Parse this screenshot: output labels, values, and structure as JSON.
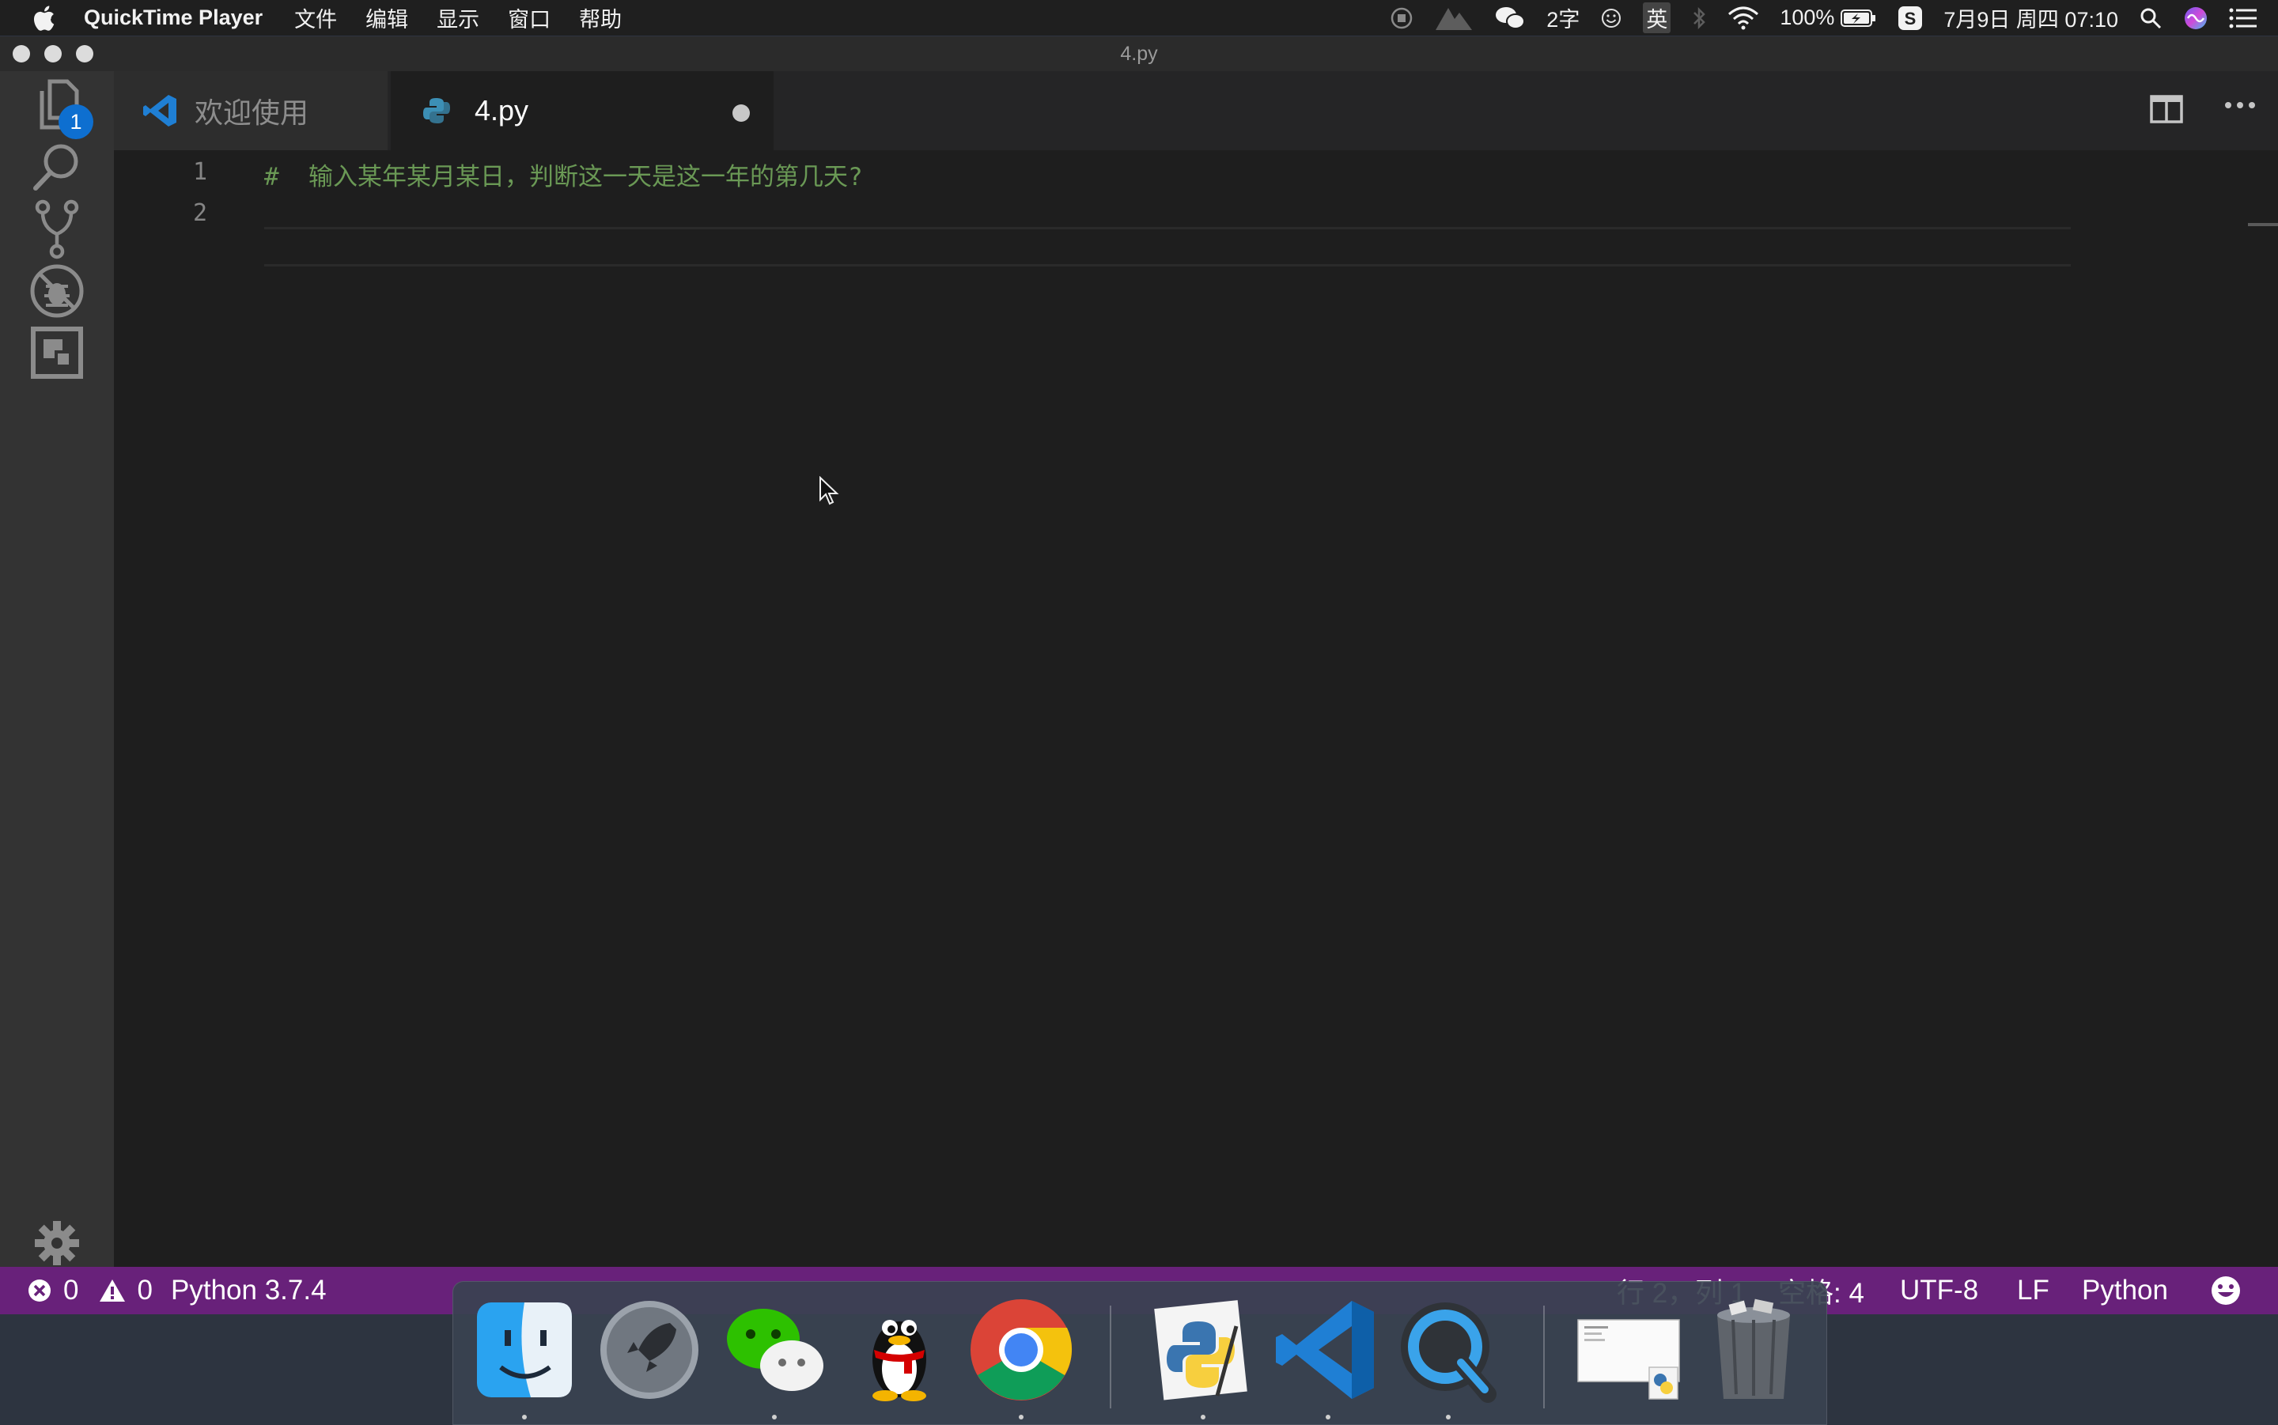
{
  "menubar": {
    "app_name": "QuickTime Player",
    "menus": [
      "文件",
      "编辑",
      "显示",
      "窗口",
      "帮助"
    ],
    "status": {
      "ime_count": "2字",
      "ime_lang": "英",
      "battery": "100%",
      "datetime": "7月9日 周四 07:10"
    }
  },
  "window": {
    "title": "4.py"
  },
  "activity_bar": {
    "explorer_badge": "1"
  },
  "tabs": [
    {
      "label": "欢迎使用",
      "active": false
    },
    {
      "label": "4.py",
      "active": true,
      "dirty": true
    }
  ],
  "editor": {
    "lines": [
      {
        "number": "1",
        "text": "#  输入某年某月某日，判断这一天是这一年的第几天?"
      },
      {
        "number": "2",
        "text": ""
      }
    ]
  },
  "statusbar": {
    "errors": "0",
    "warnings": "0",
    "interpreter": "Python 3.7.4",
    "position": "行 2，列 1",
    "indent": "空格: 4",
    "encoding": "UTF-8",
    "eol": "LF",
    "language": "Python"
  },
  "dock": {
    "apps": [
      "finder-icon",
      "launchpad-icon",
      "wechat-icon",
      "qq-icon",
      "chrome-icon",
      "python-launcher-icon",
      "vscode-icon",
      "quicktime-icon",
      "document-thumbnail-icon",
      "trash-icon"
    ]
  },
  "colors": {
    "statusbar": "#68217a",
    "comment": "#6a9955",
    "badge": "#0e6fd0"
  }
}
